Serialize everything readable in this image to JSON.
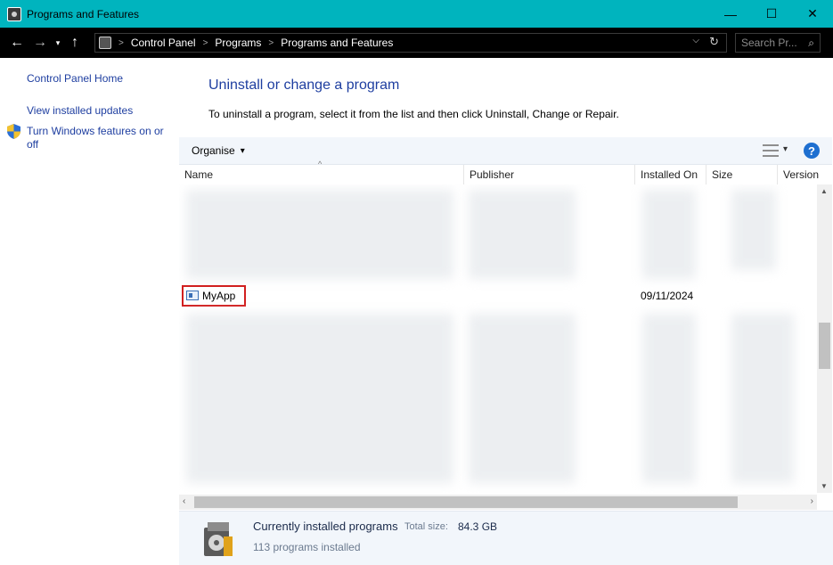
{
  "window": {
    "title": "Programs and Features",
    "controls": {
      "minimize": "—",
      "maximize": "☐",
      "close": "✕"
    }
  },
  "navigation": {
    "back": "←",
    "forward": "→",
    "recent": "▾",
    "up": "↑",
    "breadcrumb": [
      "Control Panel",
      "Programs",
      "Programs and Features"
    ],
    "separator": ">",
    "dropdown": "⌵",
    "refresh": "↻",
    "search_placeholder": "Search Pr..."
  },
  "left_pane": {
    "links": [
      "Control Panel Home",
      "View installed updates"
    ],
    "windows_features_line1": "Turn Windows features on or",
    "windows_features_line2": "off"
  },
  "main": {
    "heading": "Uninstall or change a program",
    "instructions": "To uninstall a program, select it from the list and then click Uninstall, Change or Repair."
  },
  "toolbar": {
    "organise_label": "Organise",
    "organise_arrow": "▾",
    "view_arrow": "▾",
    "help_label": "?"
  },
  "columns": [
    "Name",
    "Publisher",
    "Installed On",
    "Size",
    "Version"
  ],
  "visible_program": {
    "name": "MyApp",
    "publisher": "",
    "installed_on": "09/11/2024",
    "size": "",
    "version": ""
  },
  "details": {
    "title": "Currently installed programs",
    "total_size_label": "Total size:",
    "total_size_value": "84.3 GB",
    "count_text": "113 programs installed"
  },
  "colors": {
    "titlebar": "#00b4be",
    "link": "#1e3ea0",
    "highlight_outline": "#d11f1f"
  }
}
